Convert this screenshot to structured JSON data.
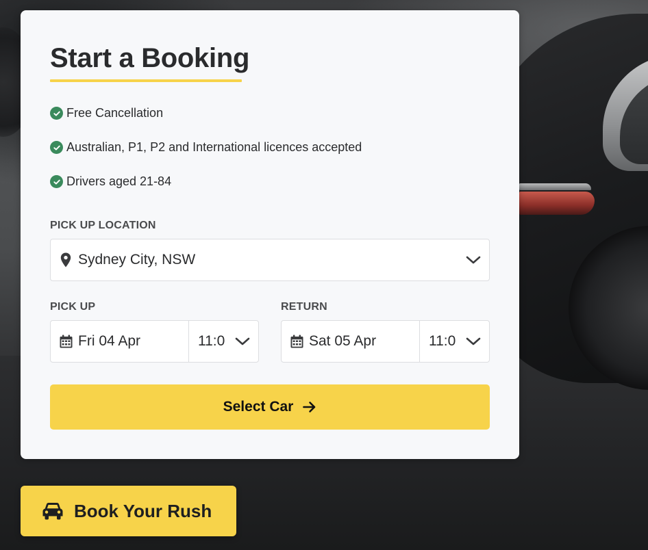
{
  "booking": {
    "title": "Start a Booking",
    "features": [
      "Free Cancellation",
      "Australian, P1, P2 and International licences accepted",
      "Drivers aged 21-84"
    ],
    "pickup_location": {
      "label": "PICK UP LOCATION",
      "value": "Sydney City, NSW"
    },
    "pickup": {
      "label": "PICK UP",
      "date": "Fri 04 Apr",
      "time": "11:0"
    },
    "return": {
      "label": "RETURN",
      "date": "Sat 05 Apr",
      "time": "11:0"
    },
    "submit_label": "Select Car"
  },
  "cta": {
    "label": "Book Your Rush"
  },
  "icons": {
    "feature": "check-circle-icon",
    "location": "map-pin-icon",
    "date": "calendar-icon",
    "dropdown": "chevron-down-icon",
    "submit": "arrow-right-icon",
    "cta": "car-icon"
  },
  "colors": {
    "accent": "#f7d34a",
    "check": "#3a8a5c",
    "text": "#2a2b2d",
    "card": "#f7f8fa"
  }
}
